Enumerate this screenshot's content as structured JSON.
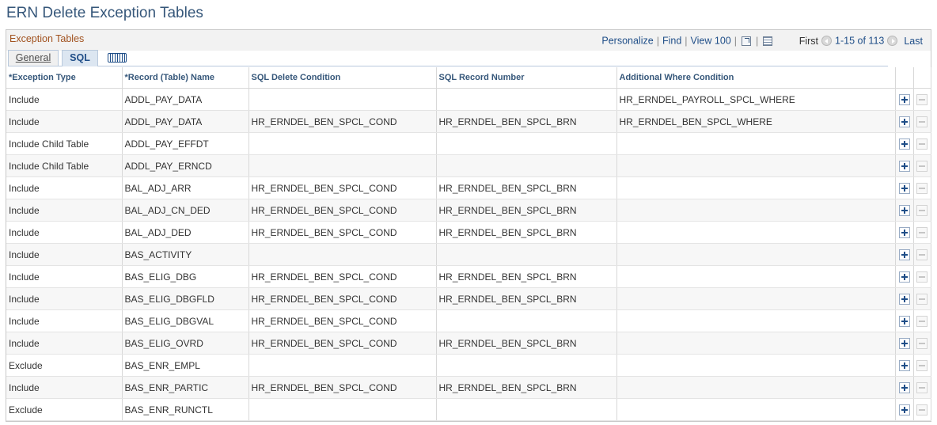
{
  "page": {
    "title": "ERN Delete Exception Tables"
  },
  "grid": {
    "title": "Exception Tables",
    "nav": {
      "personalize": "Personalize",
      "find": "Find",
      "view": "View 100",
      "first": "First",
      "count": "1-15 of 113",
      "last": "Last"
    },
    "tabs": [
      "General",
      "SQL"
    ],
    "active_tab": "SQL",
    "icons": {
      "zoom": "zoom-grid-icon",
      "download": "download-to-excel-icon",
      "prev": "previous-arrow-icon",
      "next": "next-arrow-icon",
      "show_all_columns": "show-all-columns-icon",
      "add_row": "add-row-icon",
      "delete_row": "delete-row-icon"
    },
    "columns": [
      "*Exception Type",
      "*Record (Table) Name",
      "SQL Delete Condition",
      "SQL Record Number",
      "Additional Where Condition"
    ],
    "rows": [
      [
        "Include",
        "ADDL_PAY_DATA",
        "",
        "",
        "HR_ERNDEL_PAYROLL_SPCL_WHERE"
      ],
      [
        "Include",
        "ADDL_PAY_DATA",
        "HR_ERNDEL_BEN_SPCL_COND",
        "HR_ERNDEL_BEN_SPCL_BRN",
        "HR_ERNDEL_BEN_SPCL_WHERE"
      ],
      [
        "Include Child Table",
        "ADDL_PAY_EFFDT",
        "",
        "",
        ""
      ],
      [
        "Include Child Table",
        "ADDL_PAY_ERNCD",
        "",
        "",
        ""
      ],
      [
        "Include",
        "BAL_ADJ_ARR",
        "HR_ERNDEL_BEN_SPCL_COND",
        "HR_ERNDEL_BEN_SPCL_BRN",
        ""
      ],
      [
        "Include",
        "BAL_ADJ_CN_DED",
        "HR_ERNDEL_BEN_SPCL_COND",
        "HR_ERNDEL_BEN_SPCL_BRN",
        ""
      ],
      [
        "Include",
        "BAL_ADJ_DED",
        "HR_ERNDEL_BEN_SPCL_COND",
        "HR_ERNDEL_BEN_SPCL_BRN",
        ""
      ],
      [
        "Include",
        "BAS_ACTIVITY",
        "",
        "",
        ""
      ],
      [
        "Include",
        "BAS_ELIG_DBG",
        "HR_ERNDEL_BEN_SPCL_COND",
        "HR_ERNDEL_BEN_SPCL_BRN",
        ""
      ],
      [
        "Include",
        "BAS_ELIG_DBGFLD",
        "HR_ERNDEL_BEN_SPCL_COND",
        "HR_ERNDEL_BEN_SPCL_BRN",
        ""
      ],
      [
        "Include",
        "BAS_ELIG_DBGVAL",
        "HR_ERNDEL_BEN_SPCL_COND",
        "",
        ""
      ],
      [
        "Include",
        "BAS_ELIG_OVRD",
        "HR_ERNDEL_BEN_SPCL_COND",
        "HR_ERNDEL_BEN_SPCL_BRN",
        ""
      ],
      [
        "Exclude",
        "BAS_ENR_EMPL",
        "",
        "",
        ""
      ],
      [
        "Include",
        "BAS_ENR_PARTIC",
        "HR_ERNDEL_BEN_SPCL_COND",
        "HR_ERNDEL_BEN_SPCL_BRN",
        ""
      ],
      [
        "Exclude",
        "BAS_ENR_RUNCTL",
        "",
        "",
        ""
      ]
    ]
  }
}
